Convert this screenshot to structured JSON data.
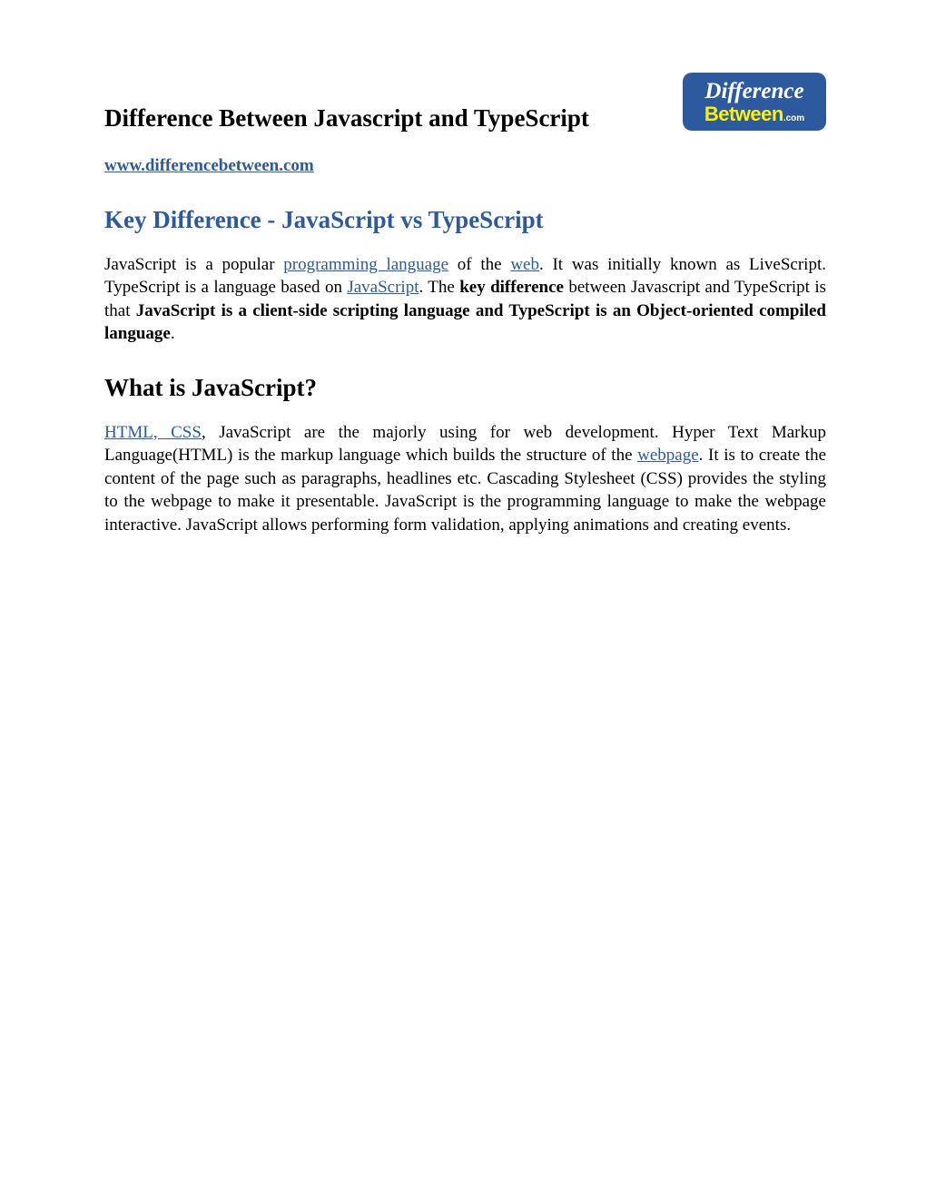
{
  "header": {
    "page_title": "Difference Between Javascript and TypeScript",
    "logo": {
      "line1": "Difference",
      "line2": "Between",
      "suffix": ".com"
    },
    "site_url": "www.differencebetween.com"
  },
  "sections": {
    "key_diff": {
      "title": "Key Difference - JavaScript vs TypeScript",
      "para": {
        "t1": "JavaScript is a popular ",
        "link1": "programming language",
        "t2": " of the ",
        "link2": "web",
        "t3": ". It was initially known as LiveScript. TypeScript is a language based on ",
        "link3": "JavaScript",
        "t4": ". The ",
        "bold1": "key difference",
        "t5": " between Javascript and TypeScript is that ",
        "bold2": "JavaScript is a client-side scripting language and TypeScript is an Object-oriented compiled language",
        "t6": "."
      }
    },
    "what_js": {
      "title": "What is JavaScript?",
      "para": {
        "t1": " ",
        "link1": "HTML, CSS",
        "t2": ", JavaScript are the majorly using for web development. Hyper Text Markup Language(HTML) is the markup language which builds the structure of the ",
        "link2": "webpage",
        "t3": ". It is to create the content of the page such as paragraphs, headlines etc. Cascading Stylesheet (CSS) provides the styling to the webpage to make it presentable. JavaScript is the programming language to make the webpage interactive. JavaScript allows performing form validation, applying animations and creating events."
      }
    }
  }
}
